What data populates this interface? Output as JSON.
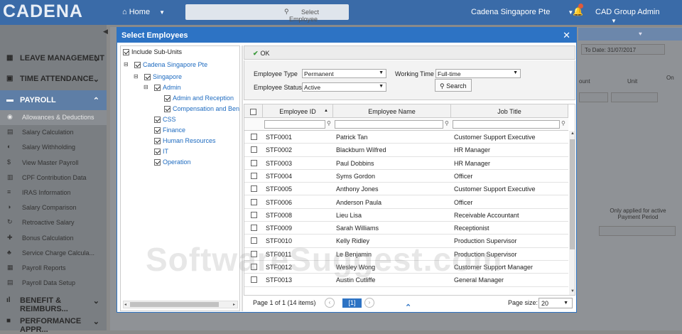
{
  "app": {
    "logo": "CADENA",
    "home_label": "Home",
    "search_placeholder": "Select Employee",
    "company": "Cadena Singapore Pte",
    "user": "CAD Group Admin"
  },
  "sidebar": {
    "sections": [
      {
        "label": "LEAVE MANAGEMENT",
        "icon": "calendar-icon"
      },
      {
        "label": "TIME ATTENDANCE",
        "icon": "clock-icon"
      },
      {
        "label": "PAYROLL",
        "icon": "money-icon"
      }
    ],
    "payroll_items": [
      {
        "label": "Allowances & Deductions",
        "icon": "coins-icon"
      },
      {
        "label": "Salary Calculation",
        "icon": "calculator-icon"
      },
      {
        "label": "Salary Withholding",
        "icon": "hand-coins-icon"
      },
      {
        "label": "View Master Payroll",
        "icon": "dollar-doc-icon"
      },
      {
        "label": "CPF Contribution Data",
        "icon": "chart-icon"
      },
      {
        "label": "IRAS Information",
        "icon": "list-icon"
      },
      {
        "label": "Salary Comparison",
        "icon": "compare-icon"
      },
      {
        "label": "Retroactive Salary",
        "icon": "retro-icon"
      },
      {
        "label": "Bonus Calculation",
        "icon": "bonus-icon"
      },
      {
        "label": "Service Charge Calcula...",
        "icon": "service-icon"
      },
      {
        "label": "Payroll Reports",
        "icon": "report-icon"
      },
      {
        "label": "Payroll Data Setup",
        "icon": "setup-icon"
      }
    ],
    "bottom_sections": [
      {
        "label": "BENEFIT & REIMBURS...",
        "icon": "benefit-icon"
      },
      {
        "label": "PERFORMANCE APPR...",
        "icon": "performance-icon"
      }
    ]
  },
  "background": {
    "to_date_label": "To Date:",
    "to_date_value": "31/07/2017",
    "col_amount": "ount",
    "col_unit": "Unit",
    "col_on": "On",
    "note_line1": "Only applied for active",
    "note_line2": "Payment Period"
  },
  "dialog": {
    "title": "Select Employees",
    "include_subunits": "Include Sub-Units",
    "tree": [
      {
        "label": "Cadena Singapore Pte"
      },
      {
        "label": "Singapore"
      },
      {
        "label": "Admin"
      },
      {
        "label": "Admin and Reception"
      },
      {
        "label": "Compensation and Ben"
      },
      {
        "label": "CSS"
      },
      {
        "label": "Finance"
      },
      {
        "label": "Human Resources"
      },
      {
        "label": "IT"
      },
      {
        "label": "Operation"
      }
    ],
    "ok_label": "OK",
    "filters": {
      "employee_type_label": "Employee Type",
      "employee_type_value": "Permanent",
      "working_time_label": "Working Time",
      "working_time_value": "Full-time",
      "employee_status_label": "Employee Status",
      "employee_status_value": "Active",
      "search_label": "Search"
    },
    "grid": {
      "columns": [
        "Employee ID",
        "Employee Name",
        "Job Title"
      ],
      "rows": [
        {
          "id": "STF0001",
          "name": "Patrick Tan",
          "title": "Customer Support Executive"
        },
        {
          "id": "STF0002",
          "name": "Blackburn Wilfred",
          "title": "HR Manager"
        },
        {
          "id": "STF0003",
          "name": "Paul Dobbins",
          "title": "HR Manager"
        },
        {
          "id": "STF0004",
          "name": "Syms Gordon",
          "title": "Officer"
        },
        {
          "id": "STF0005",
          "name": "Anthony Jones",
          "title": "Customer Support Executive"
        },
        {
          "id": "STF0006",
          "name": "Anderson Paula",
          "title": "Officer"
        },
        {
          "id": "STF0008",
          "name": "Lieu Lisa",
          "title": "Receivable Accountant"
        },
        {
          "id": "STF0009",
          "name": "Sarah Williams",
          "title": "Receptionist"
        },
        {
          "id": "STF0010",
          "name": "Kelly Ridley",
          "title": "Production Supervisor"
        },
        {
          "id": "STF0011",
          "name": "Le Benjamin",
          "title": "Production Supervisor"
        },
        {
          "id": "STF0012",
          "name": "Wesley Wong",
          "title": "Customer Support Manager"
        },
        {
          "id": "STF0013",
          "name": "Austin Cutliffe",
          "title": "General Manager"
        }
      ]
    },
    "pager": {
      "info": "Page 1 of 1 (14 items)",
      "current": "[1]",
      "size_label": "Page size:",
      "size_value": "20"
    }
  },
  "watermark": "SoftwareSuggest.com"
}
